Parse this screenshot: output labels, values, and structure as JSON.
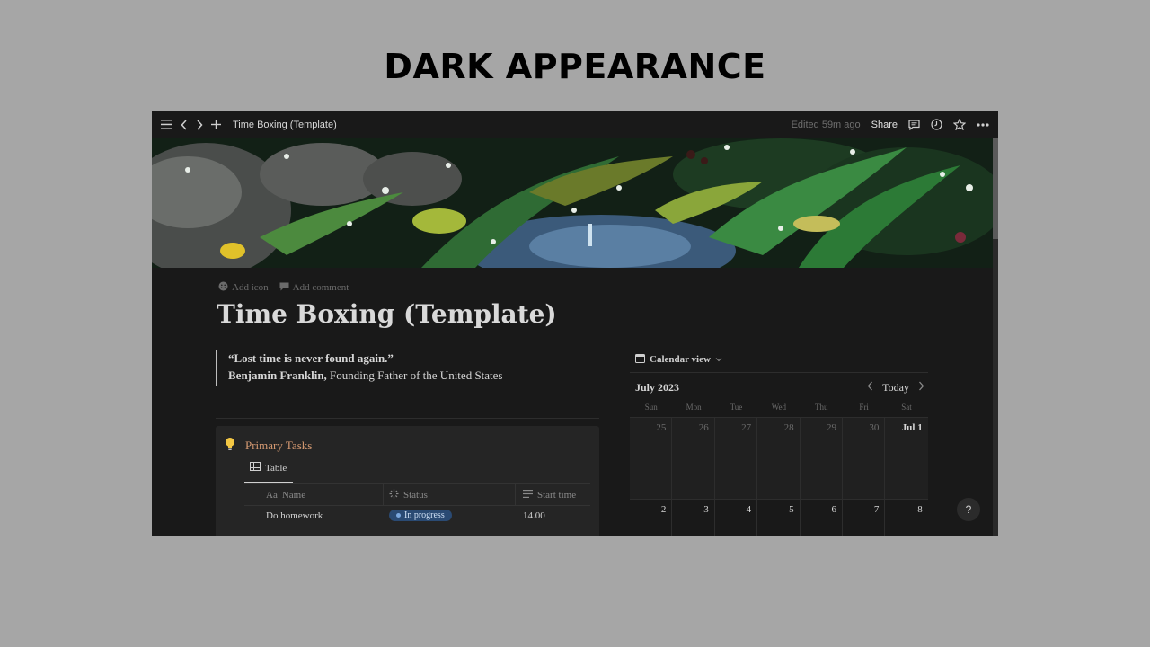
{
  "heading": "DARK APPEARANCE",
  "topbar": {
    "menu_icon": "hamburger-icon",
    "back_icon": "chevron-left-icon",
    "forward_icon": "chevron-right-icon",
    "new_icon": "plus-icon",
    "page_title": "Time Boxing (Template)",
    "edited": "Edited 59m ago",
    "share_label": "Share",
    "comment_icon": "comment-icon",
    "history_icon": "clock-icon",
    "favorite_icon": "star-icon",
    "more_icon": "more-icon"
  },
  "page": {
    "add_icon_label": "Add icon",
    "add_comment_label": "Add comment",
    "title": "Time Boxing (Template)",
    "quote_text": "“Lost time is never found again.”",
    "quote_author": "Benjamin Franklin,",
    "quote_author_desc": " Founding Father of the United States"
  },
  "callout": {
    "icon": "lightbulb-icon",
    "title": "Primary Tasks",
    "tab_label": "Table",
    "columns": [
      "Name",
      "Status",
      "Start time"
    ],
    "column_prefix": "Aa",
    "rows": [
      {
        "name": "Do homework",
        "status": "In progress",
        "start": "14.00"
      }
    ]
  },
  "calendar": {
    "view_label": "Calendar view",
    "month": "July 2023",
    "today_label": "Today",
    "days": [
      "Sun",
      "Mon",
      "Tue",
      "Wed",
      "Thu",
      "Fri",
      "Sat"
    ],
    "week1": [
      "25",
      "26",
      "27",
      "28",
      "29",
      "30",
      "Jul 1"
    ],
    "week2": [
      "2",
      "3",
      "4",
      "5",
      "6",
      "7",
      "8"
    ]
  },
  "help_label": "?",
  "colors": {
    "background": "#a6a6a6",
    "window": "#191919",
    "callout_title": "#d69a72",
    "status_badge": "#2a4a73"
  }
}
